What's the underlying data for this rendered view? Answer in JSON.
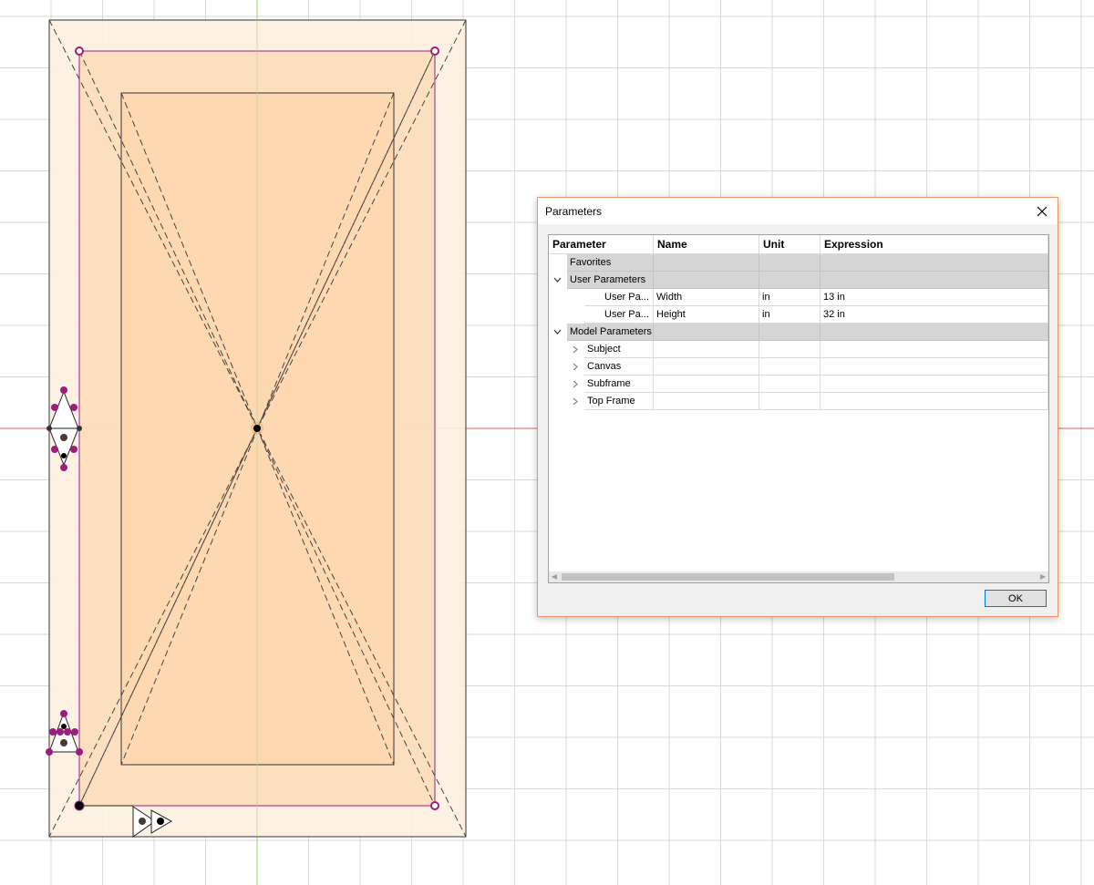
{
  "dialog": {
    "title": "Parameters",
    "ok_label": "OK"
  },
  "table": {
    "headers": [
      "Parameter",
      "Name",
      "Unit",
      "Expression"
    ],
    "groups": {
      "favorites": {
        "label": "Favorites"
      },
      "user": {
        "label": "User Parameters",
        "rows": [
          {
            "parameter": "User Pa...",
            "name": "Width",
            "unit": "in",
            "expression": "13 in"
          },
          {
            "parameter": "User Pa...",
            "name": "Height",
            "unit": "in",
            "expression": "32 in"
          }
        ]
      },
      "model": {
        "label": "Model Parameters",
        "items": [
          "Subject",
          "Canvas",
          "Subframe",
          "Top Frame"
        ]
      }
    }
  },
  "colors": {
    "outer_fill": "#fdf0e0",
    "middle_fill": "#fbdcb8",
    "inner_fill": "#fcd6ad",
    "magenta": "#9b1e7e",
    "axis_red": "#e06060",
    "axis_green": "#8fd46a",
    "dialog_border": "#e8956b"
  }
}
